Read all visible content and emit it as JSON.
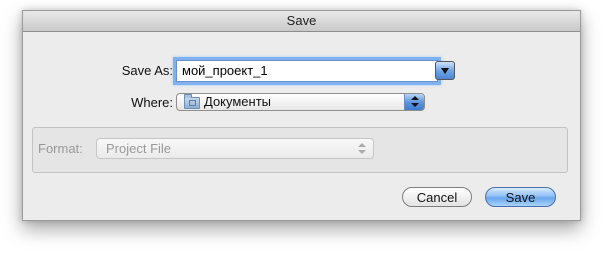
{
  "dialog": {
    "title": "Save"
  },
  "save_as": {
    "label": "Save As:",
    "value": "мой_проект_1"
  },
  "where": {
    "label": "Where:",
    "value": "Документы",
    "icon": "folder-icon"
  },
  "format": {
    "label": "Format:",
    "value": "Project File",
    "enabled": false
  },
  "buttons": {
    "cancel_label": "Cancel",
    "save_label": "Save"
  },
  "colors": {
    "accent": "#6aa6ee",
    "focus_ring": "#7fb0ef",
    "dialog_bg": "#ececec"
  }
}
